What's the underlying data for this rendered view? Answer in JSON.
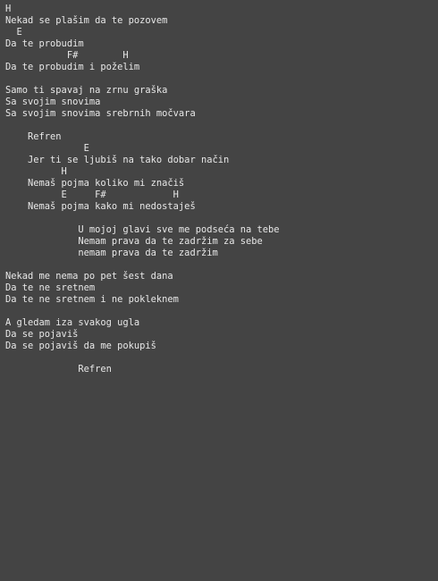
{
  "lines": [
    "H",
    "Nekad se plašim da te pozovem",
    "  E",
    "Da te probudim",
    "           F#        H",
    "Da te probudim i poželim",
    "",
    "Samo ti spavaj na zrnu graška",
    "Sa svojim snovima",
    "Sa svojim snovima srebrnih močvara",
    "",
    "    Refren",
    "              E",
    "    Jer ti se ljubiš na tako dobar način",
    "          H",
    "    Nemaš pojma koliko mi značiš",
    "          E     F#            H",
    "    Nemaš pojma kako mi nedostaješ",
    "",
    "             U mojoj glavi sve me podseća na tebe",
    "             Nemam prava da te zadržim za sebe",
    "             nemam prava da te zadržim",
    "",
    "Nekad me nema po pet šest dana",
    "Da te ne sretnem",
    "Da te ne sretnem i ne pokleknem",
    "",
    "A gledam iza svakog ugla",
    "Da se pojaviš",
    "Da se pojaviš da me pokupiš",
    "",
    "             Refren"
  ]
}
